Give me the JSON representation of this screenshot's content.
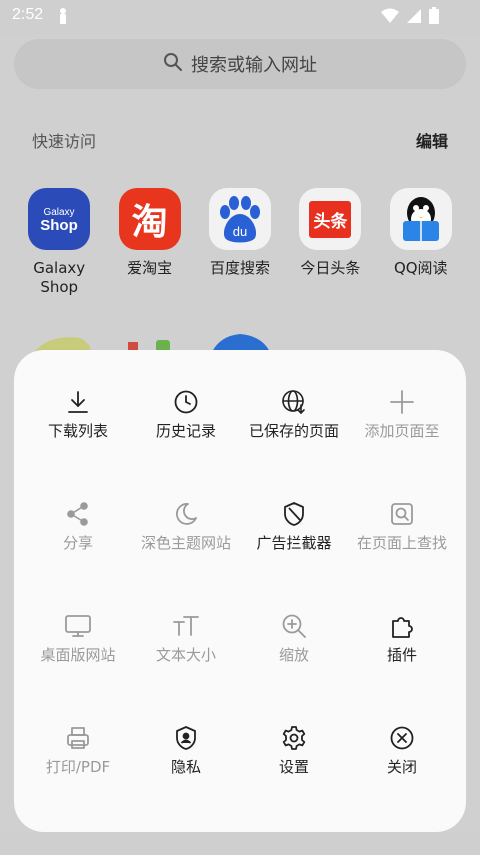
{
  "status": {
    "time": "2:52"
  },
  "search": {
    "placeholder": "搜索或输入网址"
  },
  "quick_access": {
    "title": "快速访问",
    "edit": "编辑"
  },
  "shortcuts": [
    {
      "label": "Galaxy Shop",
      "icon": "galaxy-shop-icon",
      "color": "#2a4bb8",
      "icon_text": "Galaxy Shop"
    },
    {
      "label": "爱淘宝",
      "icon": "taobao-icon",
      "color": "#e8361e",
      "icon_text": "淘"
    },
    {
      "label": "百度搜索",
      "icon": "baidu-icon",
      "color": "#2a60d6",
      "icon_text": "du"
    },
    {
      "label": "今日头条",
      "icon": "toutiao-icon",
      "color": "#e8301e",
      "icon_text": "头条"
    },
    {
      "label": "QQ阅读",
      "icon": "qq-reading-icon",
      "color": "#2b84e8"
    }
  ],
  "menu": [
    {
      "label": "下载列表",
      "icon": "download-icon",
      "enabled": true
    },
    {
      "label": "历史记录",
      "icon": "clock-icon",
      "enabled": true
    },
    {
      "label": "已保存的页面",
      "icon": "saved-pages-globe-icon",
      "enabled": true
    },
    {
      "label": "添加页面至",
      "icon": "plus-icon",
      "enabled": false
    },
    {
      "label": "分享",
      "icon": "share-icon",
      "enabled": false
    },
    {
      "label": "深色主题网站",
      "icon": "moon-icon",
      "enabled": false
    },
    {
      "label": "广告拦截器",
      "icon": "shield-icon",
      "enabled": true
    },
    {
      "label": "在页面上查找",
      "icon": "find-in-page-icon",
      "enabled": false
    },
    {
      "label": "桌面版网站",
      "icon": "desktop-icon",
      "enabled": false
    },
    {
      "label": "文本大小",
      "icon": "text-size-icon",
      "enabled": false
    },
    {
      "label": "缩放",
      "icon": "zoom-icon",
      "enabled": false
    },
    {
      "label": "插件",
      "icon": "puzzle-icon",
      "enabled": true
    },
    {
      "label": "打印/PDF",
      "icon": "print-icon",
      "enabled": false
    },
    {
      "label": "隐私",
      "icon": "privacy-shield-icon",
      "enabled": true
    },
    {
      "label": "设置",
      "icon": "gear-icon",
      "enabled": true
    },
    {
      "label": "关闭",
      "icon": "close-circle-icon",
      "enabled": true
    }
  ],
  "colors": {
    "enabled": "#222222",
    "disabled": "#9a9a9a",
    "sheet": "#fafafa",
    "backdrop": "#d0d0d0"
  }
}
